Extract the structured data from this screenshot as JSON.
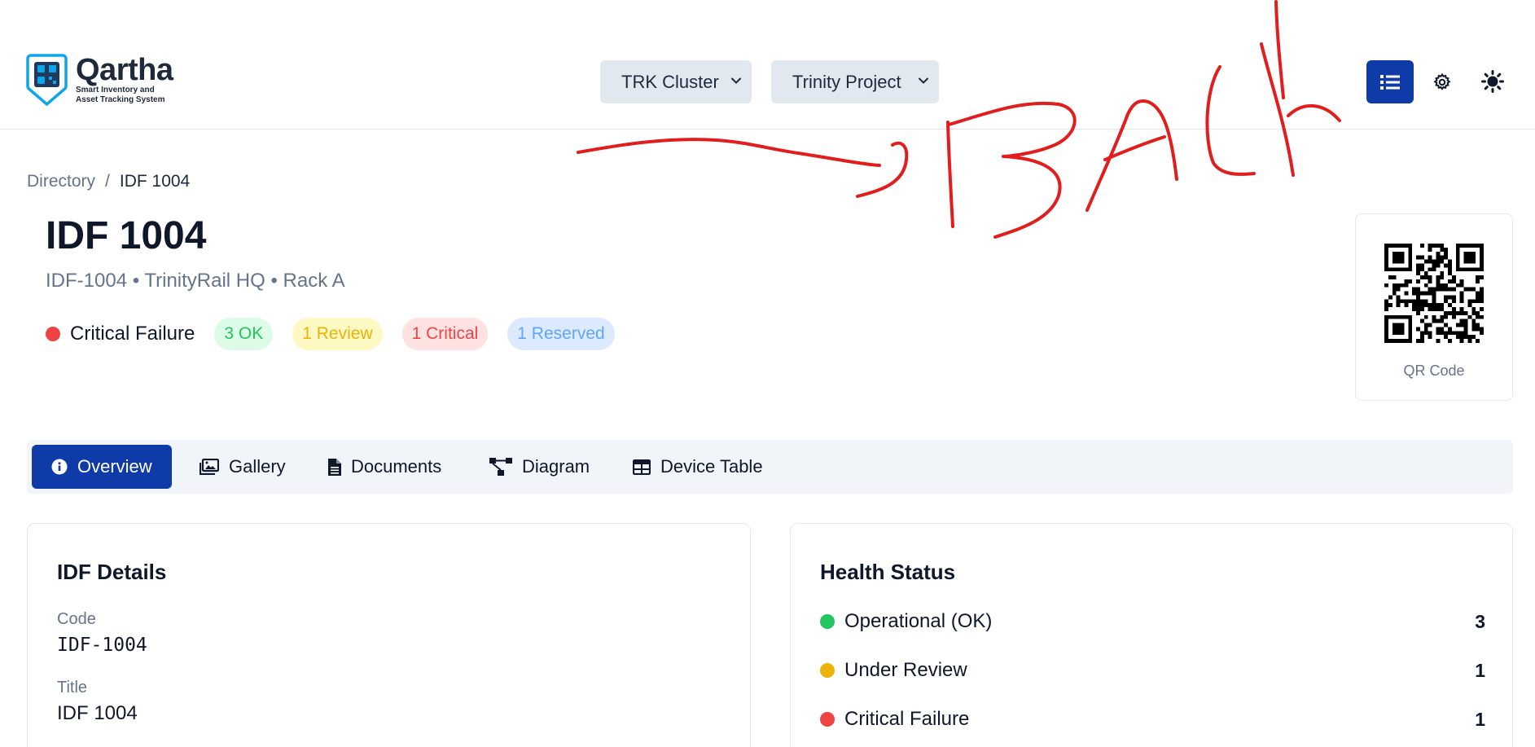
{
  "brand": {
    "name": "Qartha",
    "tagline_line1": "Smart Inventory and",
    "tagline_line2": "Asset Tracking System"
  },
  "header": {
    "cluster_select": "TRK Cluster",
    "project_select": "Trinity Project",
    "list_view_icon": "list-icon",
    "settings_icon": "gear-icon",
    "theme_icon": "sun-icon"
  },
  "breadcrumb": {
    "parent": "Directory",
    "separator": "/",
    "current": "IDF 1004"
  },
  "page": {
    "title": "IDF 1004",
    "subtitle": "IDF-1004 • TrinityRail HQ • Rack A",
    "status_label": "Critical Failure",
    "status_color": "#ef4444",
    "badges": {
      "ok": "3 OK",
      "review": "1 Review",
      "critical": "1 Critical",
      "reserved": "1 Reserved"
    }
  },
  "qr": {
    "label": "QR Code"
  },
  "tabs": [
    {
      "label": "Overview",
      "icon": "info-icon",
      "active": true
    },
    {
      "label": "Gallery",
      "icon": "gallery-icon",
      "active": false
    },
    {
      "label": "Documents",
      "icon": "document-icon",
      "active": false
    },
    {
      "label": "Diagram",
      "icon": "diagram-icon",
      "active": false
    },
    {
      "label": "Device Table",
      "icon": "table-icon",
      "active": false
    }
  ],
  "details": {
    "title": "IDF Details",
    "code_label": "Code",
    "code_value": "IDF-1004",
    "title_label": "Title",
    "title_value": "IDF 1004"
  },
  "health": {
    "title": "Health Status",
    "rows": [
      {
        "label": "Operational (OK)",
        "count": "3",
        "color": "#22c55e"
      },
      {
        "label": "Under Review",
        "count": "1",
        "color": "#eab308"
      },
      {
        "label": "Critical Failure",
        "count": "1",
        "color": "#ef4444"
      }
    ]
  },
  "annotation": {
    "text": "BACK",
    "color": "#e11d1d"
  },
  "colors": {
    "primary": "#0f3ba8",
    "brand_blue": "#0ea5e9"
  }
}
